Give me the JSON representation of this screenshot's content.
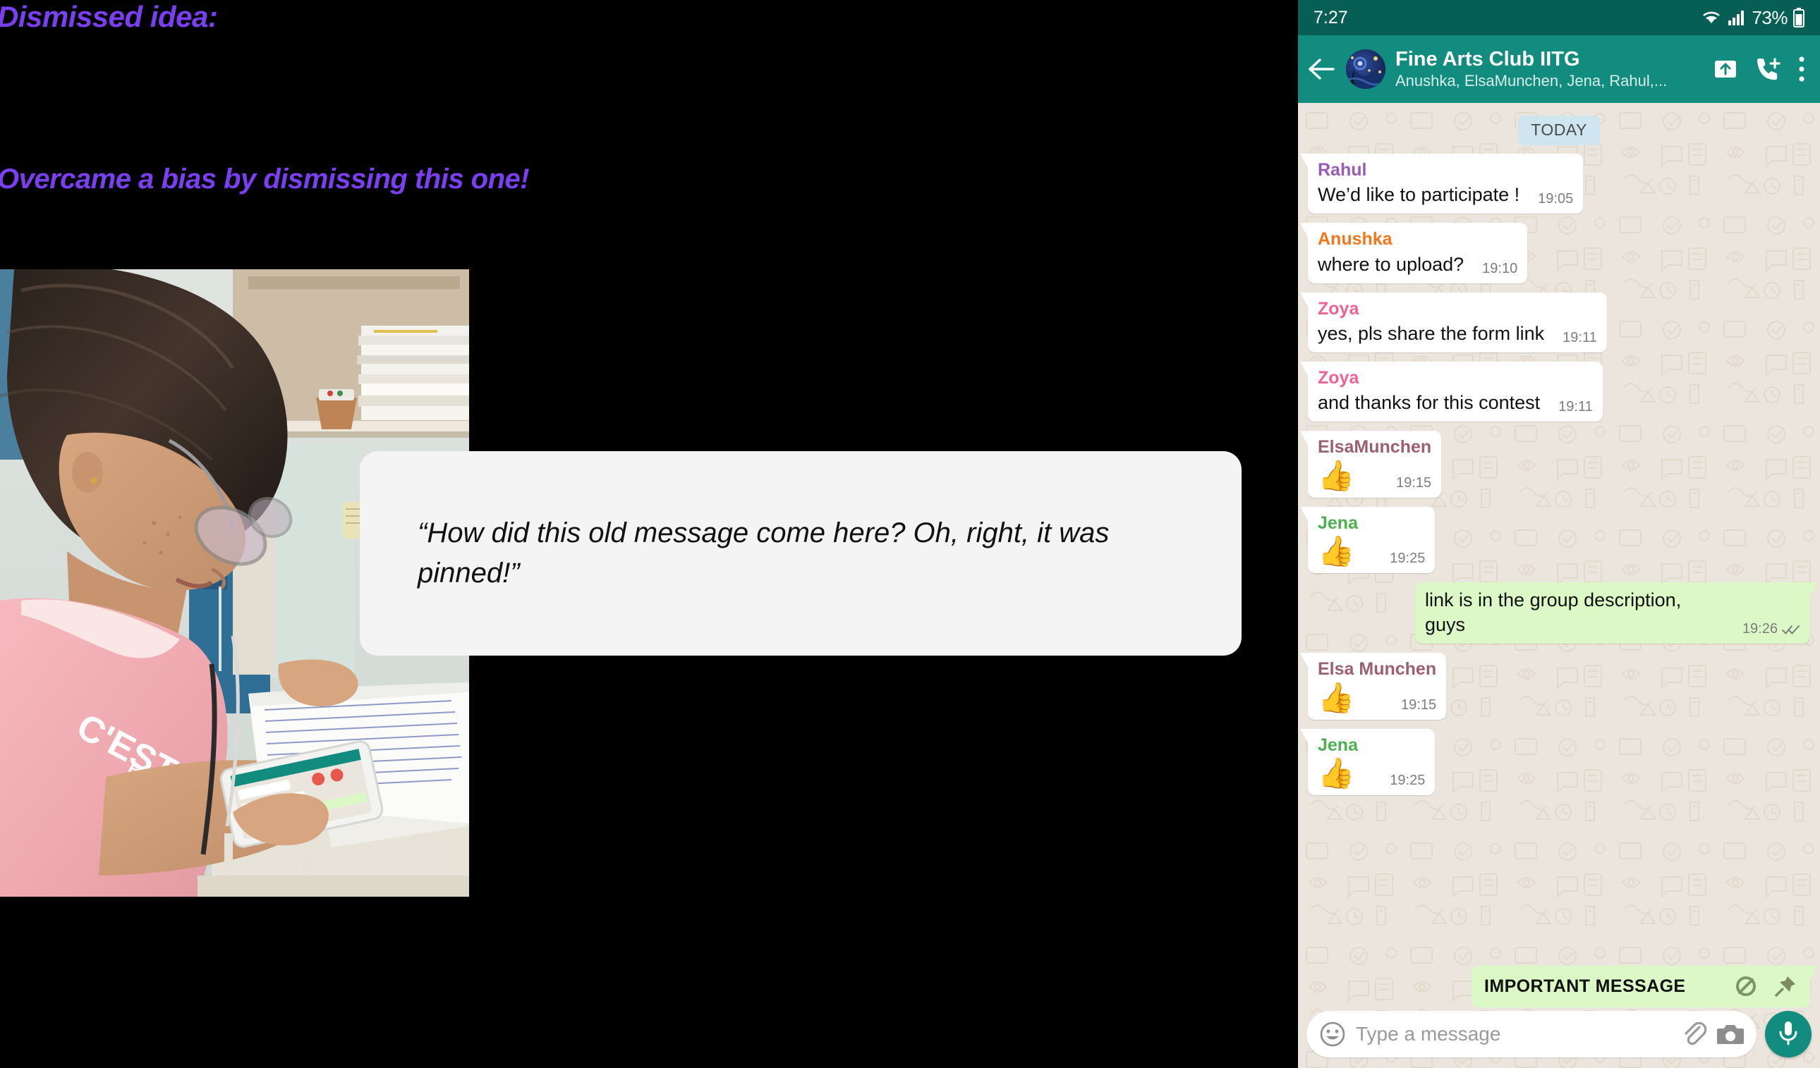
{
  "slide": {
    "heading_dismissed": "Dismissed idea:",
    "heading_overcame": "Overcame a bias by dismissing this one!",
    "quote": "“How did this old message come here? Oh, right, it was pinned!”",
    "photo_alt": "woman-reading-notes-with-phone"
  },
  "whatsapp": {
    "statusbar": {
      "clock": "7:27",
      "battery_percent": "73%",
      "wifi_icon": "wifi-icon",
      "signal_icon": "cellular-signal-icon",
      "battery_icon": "battery-icon"
    },
    "header": {
      "back_icon": "back-arrow-icon",
      "avatar_icon": "group-avatar-starry-night",
      "title": "Fine Arts Club IITG",
      "subtitle": "Anushka, ElsaMunchen, Jena, Rahul,...",
      "export_icon": "export-upload-icon",
      "add_call_icon": "add-call-icon",
      "menu_icon": "overflow-menu-icon"
    },
    "date_chip": "TODAY",
    "messages": [
      {
        "sender": "Rahul",
        "sender_color": "#9b59b6",
        "text": "We’d like to participate !",
        "time": "19:05",
        "outgoing": false,
        "is_emoji": false
      },
      {
        "sender": "Anushka",
        "sender_color": "#f5761a",
        "text": "where to upload?",
        "time": "19:10",
        "outgoing": false,
        "is_emoji": false
      },
      {
        "sender": "Zoya",
        "sender_color": "#f06292",
        "text": "yes, pls share the form link",
        "time": "19:11",
        "outgoing": false,
        "is_emoji": false
      },
      {
        "sender": "Zoya",
        "sender_color": "#f06292",
        "text": "and thanks for this contest",
        "time": "19:11",
        "outgoing": false,
        "is_emoji": false
      },
      {
        "sender": "ElsaMunchen",
        "sender_color": "#9c5f72",
        "text": "👍",
        "time": "19:15",
        "outgoing": false,
        "is_emoji": true
      },
      {
        "sender": "Jena",
        "sender_color": "#4caf50",
        "text": "👍",
        "time": "19:25",
        "outgoing": false,
        "is_emoji": true
      },
      {
        "sender": "",
        "sender_color": "",
        "text": "link is in the group description, guys",
        "time": "19:26",
        "outgoing": true,
        "is_emoji": false
      },
      {
        "sender": "Elsa Munchen",
        "sender_color": "#9c5f72",
        "text": "👍",
        "time": "19:15",
        "outgoing": false,
        "is_emoji": true
      },
      {
        "sender": "Jena",
        "sender_color": "#4caf50",
        "text": "👍",
        "time": "19:25",
        "outgoing": false,
        "is_emoji": true
      }
    ],
    "pinned": {
      "label": "IMPORTANT MESSAGE",
      "mute_icon": "mute-notifications-icon",
      "pin_icon": "pin-icon"
    },
    "input": {
      "emoji_icon": "emoji-smiley-icon",
      "placeholder": "Type a message",
      "attach_icon": "attachment-paperclip-icon",
      "camera_icon": "camera-icon",
      "mic_icon": "microphone-icon"
    },
    "colors": {
      "statusbar": "#075e54",
      "header": "#128c7e",
      "chat_bg": "#ece5dd",
      "outgoing_bubble": "#dcf8c6",
      "incoming_bubble": "#ffffff",
      "date_chip": "#cfe5f0",
      "accent": "#7b3ff2"
    }
  }
}
